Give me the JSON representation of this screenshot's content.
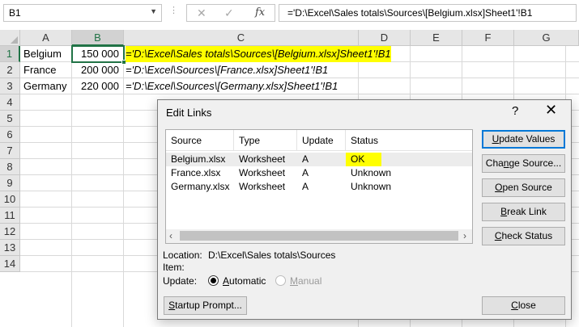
{
  "formula_bar": {
    "name_box": "B1",
    "formula": "='D:\\Excel\\Sales totals\\Sources\\[Belgium.xlsx]Sheet1'!B1",
    "cancel_icon": "x-icon",
    "enter_icon": "check-icon",
    "fx_label": "fx"
  },
  "sheet": {
    "columns": [
      "A",
      "B",
      "C",
      "D",
      "E",
      "F",
      "G"
    ],
    "rows": [
      "1",
      "2",
      "3",
      "4",
      "5",
      "6",
      "7",
      "8",
      "9",
      "10",
      "11",
      "12",
      "13",
      "14"
    ],
    "cells": [
      {
        "country": "Belgium",
        "value": "150 000",
        "formula": "='D:\\Excel\\Sales totals\\Sources\\[Belgium.xlsx]Sheet1'!B1"
      },
      {
        "country": "France",
        "value": "200 000",
        "formula": "='D:\\Excel\\Sources\\[France.xlsx]Sheet1'!B1"
      },
      {
        "country": "Germany",
        "value": "220 000",
        "formula": "='D:\\Excel\\Sources\\[Germany.xlsx]Sheet1'!B1"
      }
    ],
    "accent_color": "#217346",
    "highlight_color": "#ffff00"
  },
  "dialog": {
    "title": "Edit Links",
    "help": "?",
    "close": "✕",
    "columns": [
      "Source",
      "Type",
      "Update",
      "Status"
    ],
    "links": [
      {
        "source": "Belgium.xlsx",
        "type": "Worksheet",
        "update": "A",
        "status": "OK"
      },
      {
        "source": "France.xlsx",
        "type": "Worksheet",
        "update": "A",
        "status": "Unknown"
      },
      {
        "source": "Germany.xlsx",
        "type": "Worksheet",
        "update": "A",
        "status": "Unknown"
      }
    ],
    "buttons": {
      "update_values": {
        "pre": "",
        "key": "U",
        "post": "pdate Values"
      },
      "change_source": {
        "pre": "Cha",
        "key": "n",
        "post": "ge Source..."
      },
      "open_source": {
        "pre": "",
        "key": "O",
        "post": "pen Source"
      },
      "break_link": {
        "pre": "",
        "key": "B",
        "post": "reak Link"
      },
      "check_status": {
        "pre": "",
        "key": "C",
        "post": "heck Status"
      },
      "startup_prompt": {
        "pre": "",
        "key": "S",
        "post": "tartup Prompt..."
      },
      "close": {
        "pre": "",
        "key": "C",
        "post": "lose"
      }
    },
    "location_label": "Location:",
    "location_value": "D:\\Excel\\Sales totals\\Sources",
    "item_label": "Item:",
    "update_label": "Update:",
    "automatic": {
      "pre": "",
      "key": "A",
      "post": "utomatic"
    },
    "manual": {
      "pre": "",
      "key": "M",
      "post": "anual"
    }
  }
}
